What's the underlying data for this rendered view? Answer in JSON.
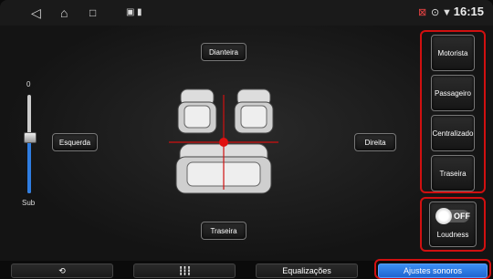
{
  "statusbar": {
    "time": "16:15",
    "icons": [
      "back-icon",
      "home-icon",
      "recents-icon",
      "notification-icon",
      "battery-icon"
    ],
    "right_icons": [
      "no-signal-icon",
      "location-icon",
      "wifi-icon"
    ]
  },
  "speakers": {
    "front": "Dianteira",
    "rear": "Traseira",
    "left": "Esquerda",
    "right": "Direita"
  },
  "slider": {
    "top_value": "0",
    "label": "Sub",
    "level": 0.55
  },
  "presets": [
    {
      "label": "Motorista"
    },
    {
      "label": "Passageiro"
    },
    {
      "label": "Centralizado"
    },
    {
      "label": "Traseira"
    }
  ],
  "loudness": {
    "label": "Loudness",
    "state": "OFF"
  },
  "bottom_tabs": [
    {
      "label": "",
      "icon": "loop-icon"
    },
    {
      "label": "",
      "icon": "equalizer-sliders-icon"
    },
    {
      "label": "Equalizações"
    },
    {
      "label": "Ajustes sonoros",
      "active": true
    }
  ],
  "colors": {
    "accent": "#2f7de1",
    "highlight": "#d01010"
  }
}
